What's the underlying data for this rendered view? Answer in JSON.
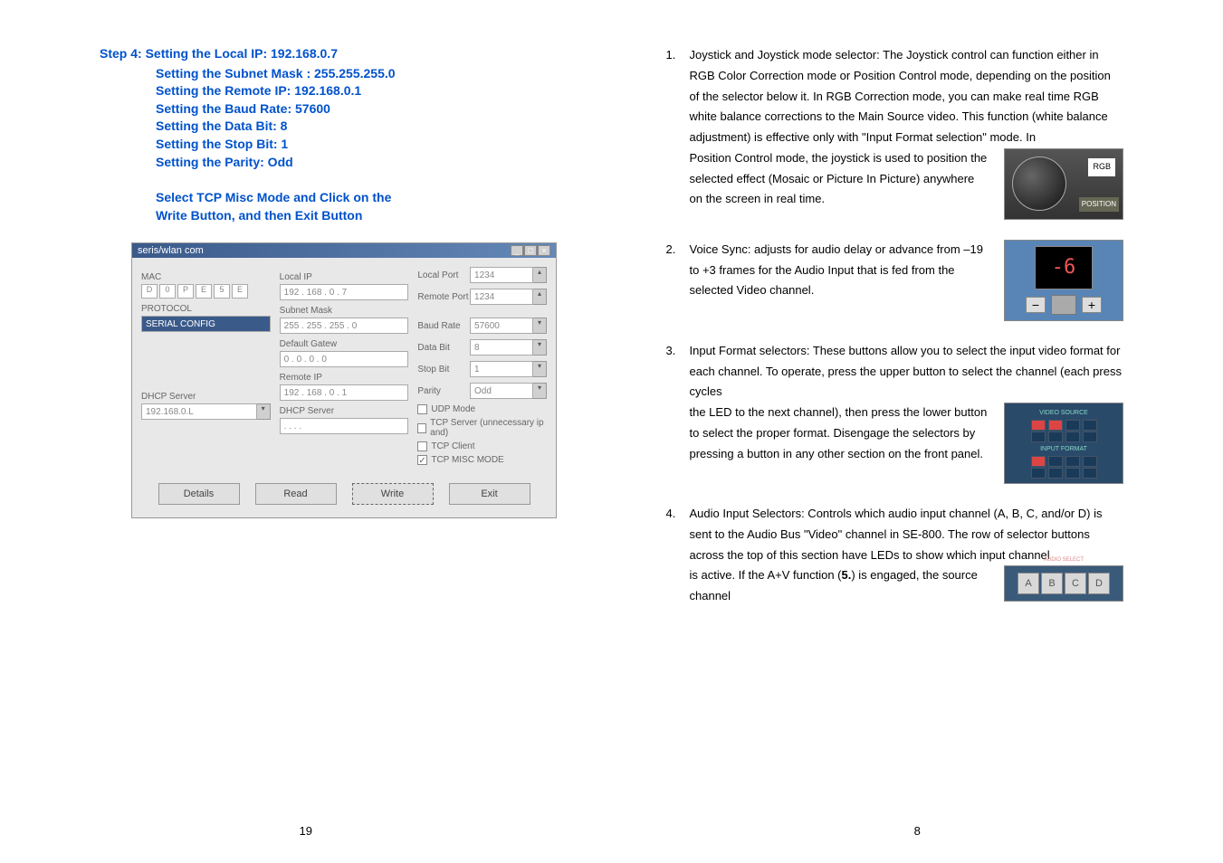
{
  "left": {
    "step_title": "Step 4: Setting the Local IP: 192.168.0.7",
    "sub1": "Setting the Subnet Mask : 255.255.255.0",
    "sub2": "Setting the Remote  IP: 192.168.0.1",
    "sub3": "Setting the Baud Rate: 57600",
    "sub4": "Setting the Data Bit: 8",
    "sub5": "Setting the Stop Bit: 1",
    "sub6": "Setting the Parity: Odd",
    "action1": "Select TCP Misc Mode and Click on the",
    "action2": "Write Button, and then Exit Button",
    "dialog": {
      "title": "seris/wlan com",
      "lbl_mac": "MAC",
      "lbl_local": "Local IP",
      "val_local": "192 . 168 . 0 . 7",
      "lbl_subnet": "Subnet Mask",
      "val_subnet": "255 . 255 . 255 . 0",
      "lbl_default": "Default Gatew",
      "val_default": "0 . 0 . 0 . 0",
      "lbl_remote": "Remote IP",
      "val_remote": "192 . 168 . 0 . 1",
      "lbl_dhcp": "DHCP Server",
      "lbl_proto": "PROTOCOL",
      "lbl_localport": "Local Port",
      "val_localport": "1234",
      "lbl_remoteport": "Remote Port",
      "val_remoteport": "1234",
      "lbl_baud": "Baud Rate",
      "val_baud": "57600",
      "lbl_databit": "Data Bit",
      "val_databit": "8",
      "lbl_stopbit": "Stop Bit",
      "val_stopbit": "1",
      "lbl_parity": "Parity",
      "val_parity": "Odd",
      "chk_udp": "UDP Mode",
      "chk_tcp_server": "TCP Server (unnecessary ip and)",
      "chk_tcp_client": "TCP Client",
      "chk_tcp_misc": "TCP MISC MODE",
      "btn_detail": "Details",
      "btn_read": "Read",
      "btn_write": "Write",
      "btn_ask": "Exit",
      "val_proto": "192.168.0.L"
    },
    "page_num": "19"
  },
  "right": {
    "items": {
      "1": {
        "num": "1.",
        "main": "Joystick and Joystick mode selector: The Joystick control can function either in RGB Color Correction mode or Position Control mode, depending on the position of the selector below it. In RGB Correction mode, you can make real time RGB white balance corrections to the Main Source video. This function (white balance adjustment) is effective only with \"Input Format selection\" mode. In",
        "wrapped": "Position Control mode, the joystick is used to position the selected effect (Mosaic or Picture In Picture) anywhere on the screen in real time.",
        "lbl1": "RGB",
        "lbl2": "POSITION"
      },
      "2": {
        "num": "2.",
        "wrapped": "Voice Sync: adjusts for audio delay or advance from –19 to +3 frames for the Audio Input that is fed from the selected Video channel.",
        "display": "-6",
        "minus": "−",
        "plus": "+"
      },
      "3": {
        "num": "3.",
        "main": "Input Format selectors: These buttons allow you to select the input video format for each channel. To operate, press the upper button to select the channel (each press cycles",
        "wrapped": "the LED to the next channel), then press the lower button to select the proper format. Disengage the selectors by pressing a button in any other section on the front panel.",
        "hdr1": "VIDEO SOURCE",
        "hdr2": "INPUT FORMAT"
      },
      "4": {
        "num": "4.",
        "main": "Audio Input Selectors: Controls which audio input channel (A, B, C, and/or D) is sent to the Audio Bus \"Video\" channel in SE-800. The row of selector buttons across the top of this section have LEDs to show which input channel",
        "wrapped_a": "is active. If the A+V function (",
        "wrapped_bold": "5.",
        "wrapped_b": ") is engaged, the source channel",
        "hdr": "AUDIO SELECT",
        "btns": {
          "a": "A",
          "b": "B",
          "c": "C",
          "d": "D"
        }
      }
    },
    "page_num": "8"
  }
}
